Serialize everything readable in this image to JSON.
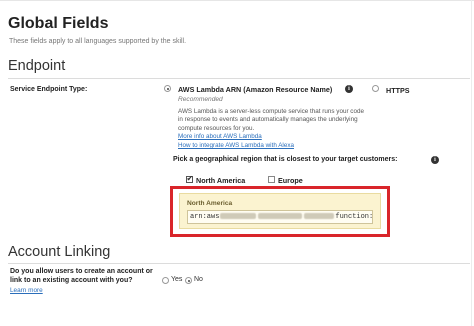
{
  "global_fields": {
    "title": "Global Fields",
    "subtitle": "These fields apply to all languages supported by the skill."
  },
  "endpoint": {
    "title": "Endpoint",
    "service_type_label": "Service Endpoint Type:",
    "lambda_option": {
      "label": "AWS Lambda ARN (Amazon Resource Name)",
      "selected": true,
      "recommended": "Recommended",
      "description": "AWS Lambda is a server-less compute service that runs your code in response to events and automatically manages the underlying compute resources for you.",
      "link_more": "More info about AWS Lambda",
      "link_integrate": "How to integrate AWS Lambda with Alexa"
    },
    "https_option": {
      "label": "HTTPS",
      "selected": false
    },
    "region_prompt": "Pick a geographical region that is closest to your target customers:",
    "regions": [
      {
        "label": "North America",
        "checked": true
      },
      {
        "label": "Europe",
        "checked": false
      }
    ],
    "selected_region": {
      "label": "North America",
      "arn_prefix": "arn:aws",
      "arn_suffix": "function:a"
    }
  },
  "account_linking": {
    "title": "Account Linking",
    "question": "Do you allow users to create an account or link to an existing account with you?",
    "learn_more": "Learn more",
    "yes_label": "Yes",
    "no_label": "No",
    "selected": "No"
  },
  "colors": {
    "highlight_border": "#d9252a",
    "region_panel_bg": "#fbf3d0",
    "link": "#2a6ebb"
  }
}
